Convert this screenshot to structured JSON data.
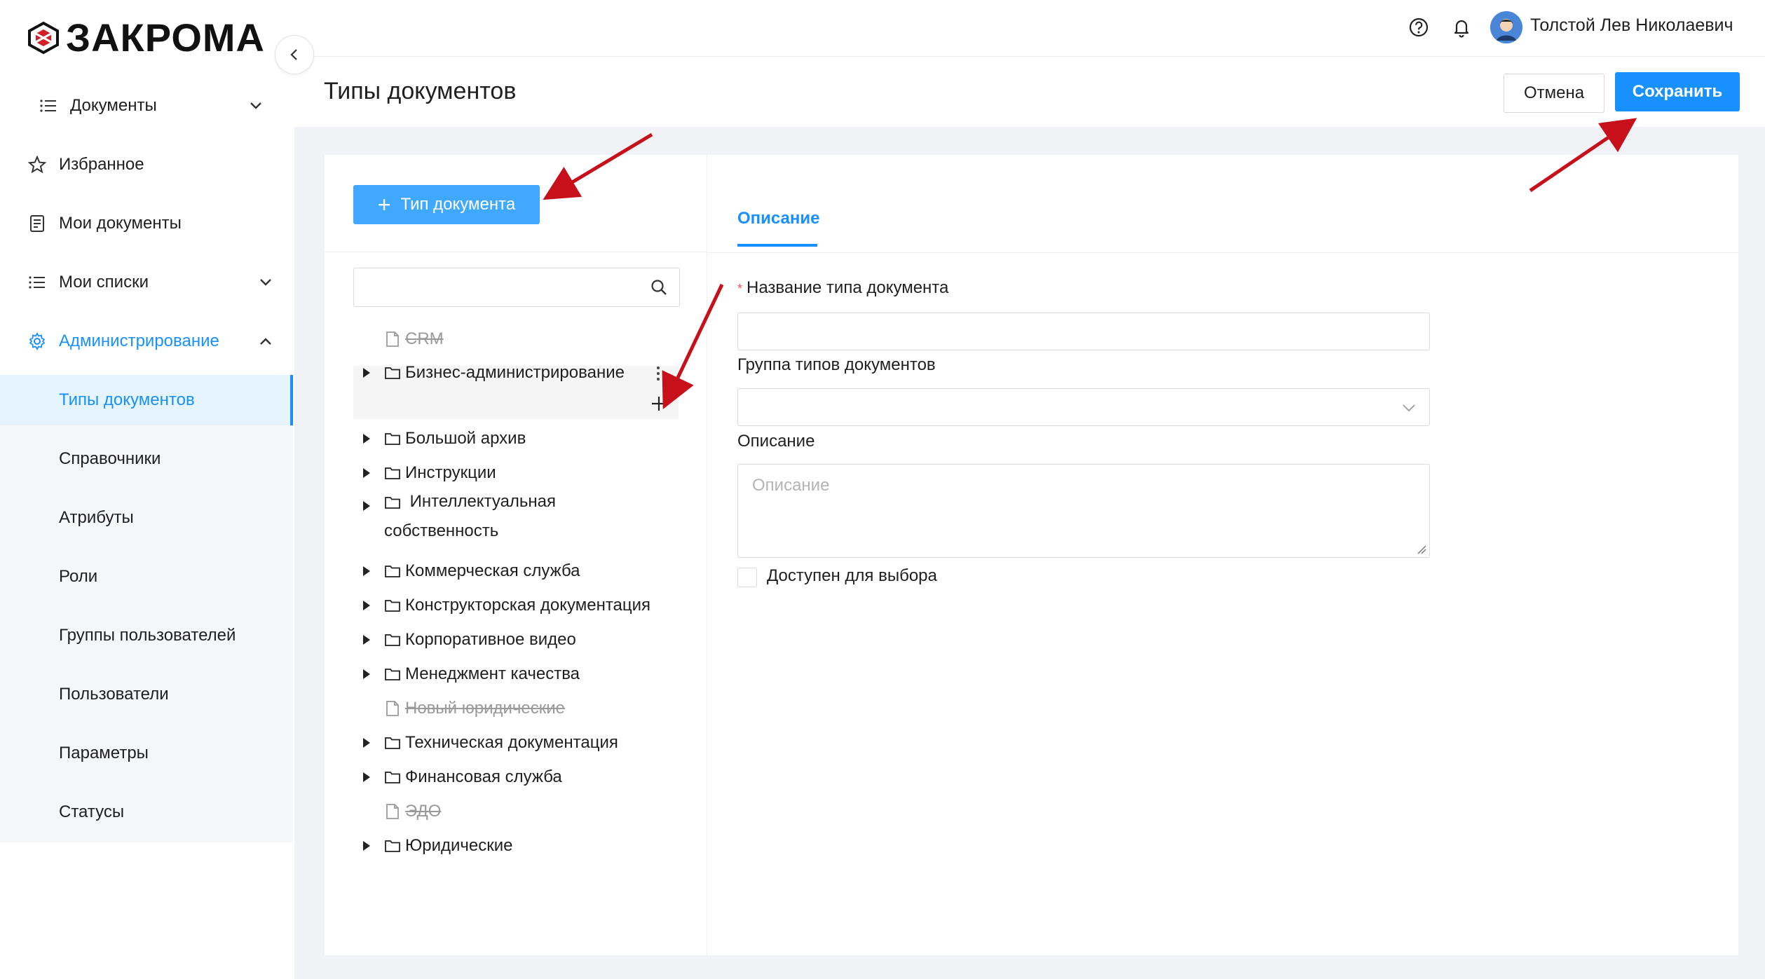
{
  "app": {
    "logo_text": "ЗАКРОМА"
  },
  "sidebar": {
    "items": [
      {
        "label": "Документы",
        "icon": "list-icon",
        "chevron": "down"
      },
      {
        "label": "Избранное",
        "icon": "star-icon"
      },
      {
        "label": "Мои документы",
        "icon": "document-icon"
      },
      {
        "label": "Мои списки",
        "icon": "list-icon",
        "chevron": "down"
      },
      {
        "label": "Администрирование",
        "icon": "gear-icon",
        "chevron": "up"
      }
    ],
    "admin_items": [
      "Типы документов",
      "Справочники",
      "Атрибуты",
      "Роли",
      "Группы пользователей",
      "Пользователи",
      "Параметры",
      "Статусы"
    ],
    "active_item": "Типы документов"
  },
  "header": {
    "user_name": "Толстой Лев Николаевич"
  },
  "page": {
    "title": "Типы документов",
    "cancel_label": "Отмена",
    "save_label": "Сохранить"
  },
  "tree_panel": {
    "add_button_label": "Тип документа",
    "search_value": "",
    "items": [
      {
        "label": "CRM",
        "type": "file",
        "disabled": true
      },
      {
        "label": "Бизнес-администрирование",
        "type": "folder",
        "expandable": true,
        "hovered": true
      },
      {
        "label": "Большой архив",
        "type": "folder",
        "expandable": true
      },
      {
        "label": "Инструкции",
        "type": "folder",
        "expandable": true
      },
      {
        "label": "Интеллектуальная собственность",
        "type": "folder",
        "expandable": true
      },
      {
        "label": "Коммерческая служба",
        "type": "folder",
        "expandable": true
      },
      {
        "label": "Конструкторская документация",
        "type": "folder",
        "expandable": true
      },
      {
        "label": "Корпоративное видео",
        "type": "folder",
        "expandable": true
      },
      {
        "label": "Менеджмент качества",
        "type": "folder",
        "expandable": true
      },
      {
        "label": "Новый юридические",
        "type": "file",
        "disabled": true
      },
      {
        "label": "Техническая документация",
        "type": "folder",
        "expandable": true
      },
      {
        "label": "Финансовая служба",
        "type": "folder",
        "expandable": true
      },
      {
        "label": "ЭДО",
        "type": "file",
        "disabled": true
      },
      {
        "label": "Юридические",
        "type": "folder",
        "expandable": true
      }
    ]
  },
  "form": {
    "tab_label": "Описание",
    "name_label": "Название типа документа",
    "name_value": "",
    "group_label": "Группа типов документов",
    "group_value": "",
    "description_label": "Описание",
    "description_placeholder": "Описание",
    "available_label": "Доступен для выбора",
    "available_checked": false
  },
  "colors": {
    "accent": "#1890ff",
    "annotation_arrow": "#c8101a"
  }
}
